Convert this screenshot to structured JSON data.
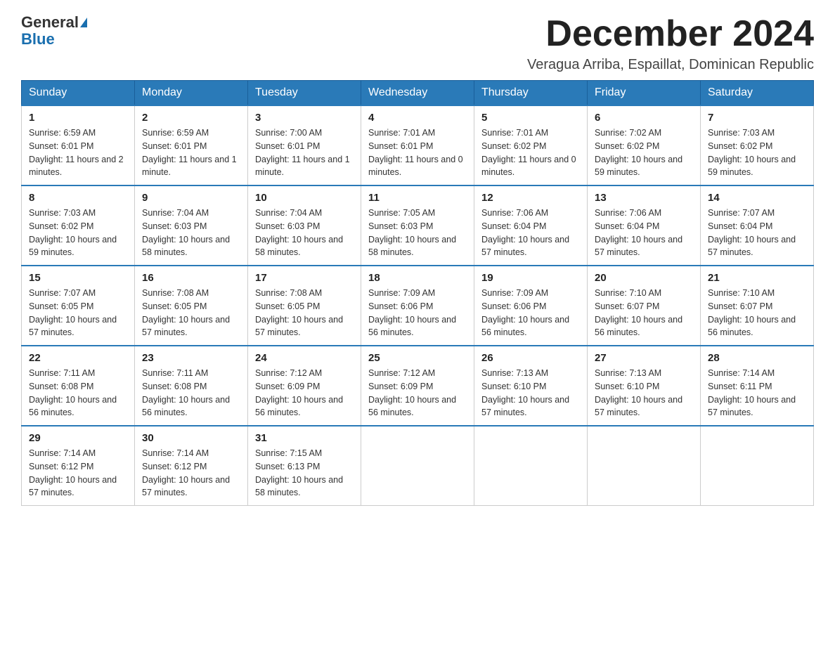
{
  "logo": {
    "general": "General",
    "blue": "Blue"
  },
  "title": "December 2024",
  "location": "Veragua Arriba, Espaillat, Dominican Republic",
  "days_of_week": [
    "Sunday",
    "Monday",
    "Tuesday",
    "Wednesday",
    "Thursday",
    "Friday",
    "Saturday"
  ],
  "weeks": [
    [
      {
        "day": "1",
        "sunrise": "6:59 AM",
        "sunset": "6:01 PM",
        "daylight": "11 hours and 2 minutes."
      },
      {
        "day": "2",
        "sunrise": "6:59 AM",
        "sunset": "6:01 PM",
        "daylight": "11 hours and 1 minute."
      },
      {
        "day": "3",
        "sunrise": "7:00 AM",
        "sunset": "6:01 PM",
        "daylight": "11 hours and 1 minute."
      },
      {
        "day": "4",
        "sunrise": "7:01 AM",
        "sunset": "6:01 PM",
        "daylight": "11 hours and 0 minutes."
      },
      {
        "day": "5",
        "sunrise": "7:01 AM",
        "sunset": "6:02 PM",
        "daylight": "11 hours and 0 minutes."
      },
      {
        "day": "6",
        "sunrise": "7:02 AM",
        "sunset": "6:02 PM",
        "daylight": "10 hours and 59 minutes."
      },
      {
        "day": "7",
        "sunrise": "7:03 AM",
        "sunset": "6:02 PM",
        "daylight": "10 hours and 59 minutes."
      }
    ],
    [
      {
        "day": "8",
        "sunrise": "7:03 AM",
        "sunset": "6:02 PM",
        "daylight": "10 hours and 59 minutes."
      },
      {
        "day": "9",
        "sunrise": "7:04 AM",
        "sunset": "6:03 PM",
        "daylight": "10 hours and 58 minutes."
      },
      {
        "day": "10",
        "sunrise": "7:04 AM",
        "sunset": "6:03 PM",
        "daylight": "10 hours and 58 minutes."
      },
      {
        "day": "11",
        "sunrise": "7:05 AM",
        "sunset": "6:03 PM",
        "daylight": "10 hours and 58 minutes."
      },
      {
        "day": "12",
        "sunrise": "7:06 AM",
        "sunset": "6:04 PM",
        "daylight": "10 hours and 57 minutes."
      },
      {
        "day": "13",
        "sunrise": "7:06 AM",
        "sunset": "6:04 PM",
        "daylight": "10 hours and 57 minutes."
      },
      {
        "day": "14",
        "sunrise": "7:07 AM",
        "sunset": "6:04 PM",
        "daylight": "10 hours and 57 minutes."
      }
    ],
    [
      {
        "day": "15",
        "sunrise": "7:07 AM",
        "sunset": "6:05 PM",
        "daylight": "10 hours and 57 minutes."
      },
      {
        "day": "16",
        "sunrise": "7:08 AM",
        "sunset": "6:05 PM",
        "daylight": "10 hours and 57 minutes."
      },
      {
        "day": "17",
        "sunrise": "7:08 AM",
        "sunset": "6:05 PM",
        "daylight": "10 hours and 57 minutes."
      },
      {
        "day": "18",
        "sunrise": "7:09 AM",
        "sunset": "6:06 PM",
        "daylight": "10 hours and 56 minutes."
      },
      {
        "day": "19",
        "sunrise": "7:09 AM",
        "sunset": "6:06 PM",
        "daylight": "10 hours and 56 minutes."
      },
      {
        "day": "20",
        "sunrise": "7:10 AM",
        "sunset": "6:07 PM",
        "daylight": "10 hours and 56 minutes."
      },
      {
        "day": "21",
        "sunrise": "7:10 AM",
        "sunset": "6:07 PM",
        "daylight": "10 hours and 56 minutes."
      }
    ],
    [
      {
        "day": "22",
        "sunrise": "7:11 AM",
        "sunset": "6:08 PM",
        "daylight": "10 hours and 56 minutes."
      },
      {
        "day": "23",
        "sunrise": "7:11 AM",
        "sunset": "6:08 PM",
        "daylight": "10 hours and 56 minutes."
      },
      {
        "day": "24",
        "sunrise": "7:12 AM",
        "sunset": "6:09 PM",
        "daylight": "10 hours and 56 minutes."
      },
      {
        "day": "25",
        "sunrise": "7:12 AM",
        "sunset": "6:09 PM",
        "daylight": "10 hours and 56 minutes."
      },
      {
        "day": "26",
        "sunrise": "7:13 AM",
        "sunset": "6:10 PM",
        "daylight": "10 hours and 57 minutes."
      },
      {
        "day": "27",
        "sunrise": "7:13 AM",
        "sunset": "6:10 PM",
        "daylight": "10 hours and 57 minutes."
      },
      {
        "day": "28",
        "sunrise": "7:14 AM",
        "sunset": "6:11 PM",
        "daylight": "10 hours and 57 minutes."
      }
    ],
    [
      {
        "day": "29",
        "sunrise": "7:14 AM",
        "sunset": "6:12 PM",
        "daylight": "10 hours and 57 minutes."
      },
      {
        "day": "30",
        "sunrise": "7:14 AM",
        "sunset": "6:12 PM",
        "daylight": "10 hours and 57 minutes."
      },
      {
        "day": "31",
        "sunrise": "7:15 AM",
        "sunset": "6:13 PM",
        "daylight": "10 hours and 58 minutes."
      },
      null,
      null,
      null,
      null
    ]
  ]
}
